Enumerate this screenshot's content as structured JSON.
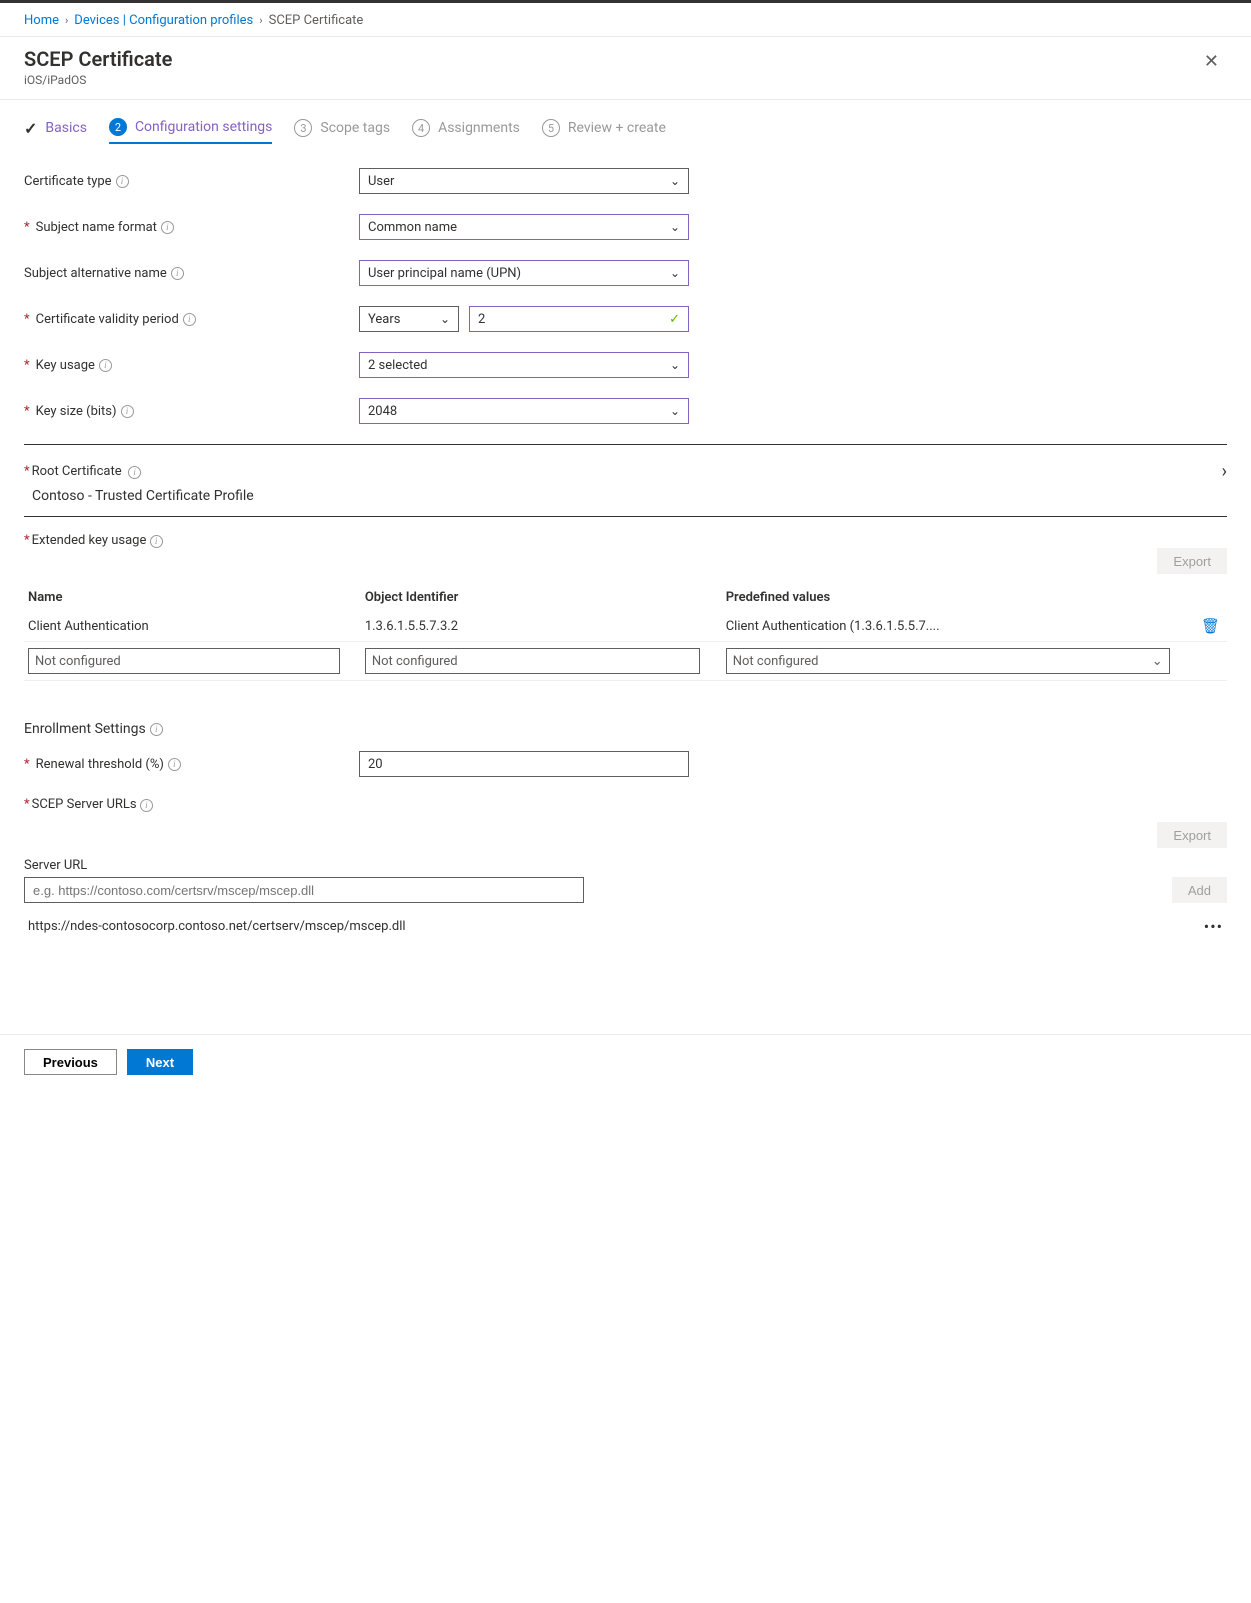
{
  "breadcrumb": {
    "home": "Home",
    "devices": "Devices | Configuration profiles",
    "current": "SCEP Certificate"
  },
  "header": {
    "title": "SCEP Certificate",
    "subtitle": "iOS/iPadOS"
  },
  "steps": {
    "s1": "Basics",
    "s2": "Configuration settings",
    "s3": "Scope tags",
    "s4": "Assignments",
    "s5": "Review + create"
  },
  "labels": {
    "cert_type": "Certificate type",
    "subj_name": "Subject name format",
    "san": "Subject alternative name",
    "validity": "Certificate validity period",
    "key_usage": "Key usage",
    "key_size": "Key size (bits)",
    "root_cert": "Root Certificate",
    "eku": "Extended key usage",
    "enroll": "Enrollment Settings",
    "renewal": "Renewal threshold (%)",
    "scep_urls": "SCEP Server URLs",
    "server_url_h": "Server URL"
  },
  "values": {
    "cert_type": "User",
    "subj_name": "Common name",
    "san": "User principal name (UPN)",
    "validity_unit": "Years",
    "validity_num": "2",
    "key_usage": "2 selected",
    "key_size": "2048",
    "root_cert": "Contoso - Trusted Certificate Profile",
    "renewal": "20",
    "server_url_placeholder": "e.g. https://contoso.com/certsrv/mscep/mscep.dll",
    "server_url_1": "https://ndes-contosocorp.contoso.net/certserv/mscep/mscep.dll"
  },
  "eku_table": {
    "h_name": "Name",
    "h_oid": "Object Identifier",
    "h_pre": "Predefined values",
    "row1_name": "Client Authentication",
    "row1_oid": "1.3.6.1.5.5.7.3.2",
    "row1_pre": "Client Authentication (1.3.6.1.5.5.7....",
    "not_conf": "Not configured"
  },
  "buttons": {
    "export": "Export",
    "add": "Add",
    "prev": "Previous",
    "next": "Next"
  }
}
